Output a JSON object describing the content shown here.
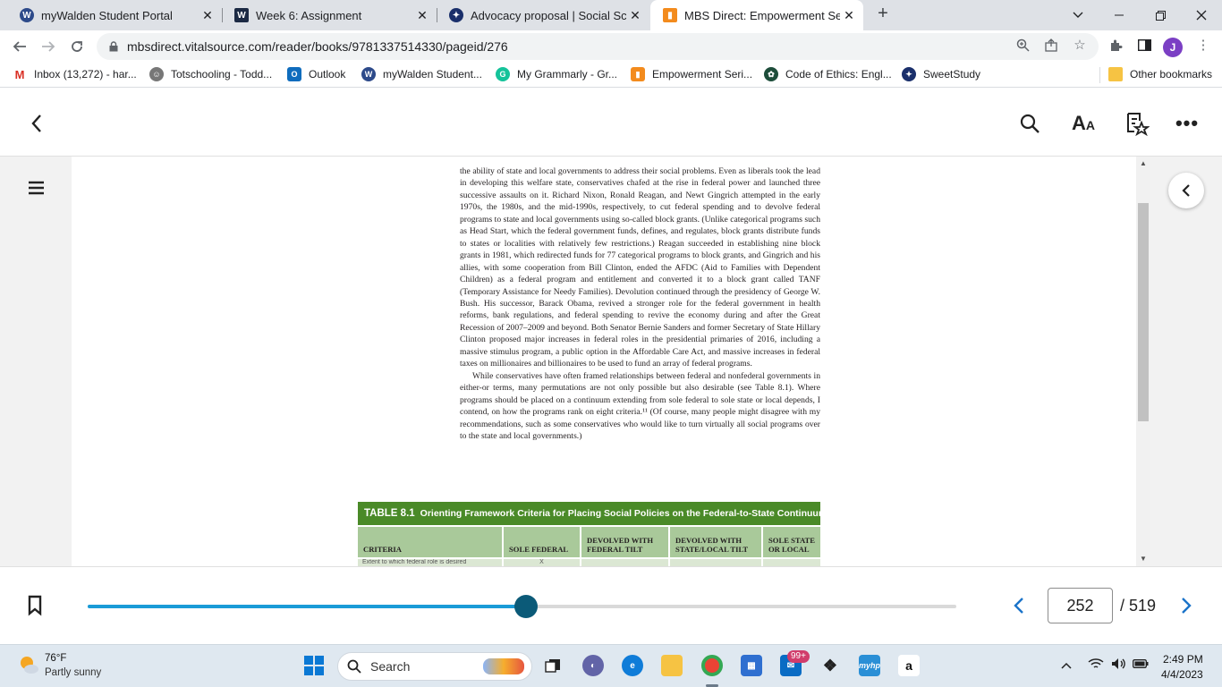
{
  "browser": {
    "tabs": [
      {
        "title": "myWalden Student Portal",
        "icon": "walden-w-icon",
        "color": "#2d4a8a"
      },
      {
        "title": "Week 6: Assignment",
        "icon": "walden-w-square-icon",
        "color": "#1c2a44"
      },
      {
        "title": "Advocacy proposal | Social Scienc",
        "icon": "sweetstudy-icon",
        "color": "#1a2f6b"
      },
      {
        "title": "MBS Direct: Empowerment Series",
        "icon": "mbs-icon",
        "color": "#f38b1d"
      }
    ],
    "url": "mbsdirect.vitalsource.com/reader/books/9781337514330/pageid/276",
    "profile_initial": "J",
    "bookmarks": [
      {
        "label": "Inbox (13,272) - har...",
        "icon": "gmail-icon",
        "color": "#d93025"
      },
      {
        "label": "Totschooling - Todd...",
        "icon": "totschooling-icon",
        "color": "#555555"
      },
      {
        "label": "Outlook",
        "icon": "outlook-icon",
        "color": "#0f6cbd"
      },
      {
        "label": "myWalden Student...",
        "icon": "walden-icon",
        "color": "#2d4a8a"
      },
      {
        "label": "My Grammarly - Gr...",
        "icon": "grammarly-icon",
        "color": "#15c39a"
      },
      {
        "label": "Empowerment Seri...",
        "icon": "mbs-icon",
        "color": "#f38b1d"
      },
      {
        "label": "Code of Ethics: Engl...",
        "icon": "nasw-icon",
        "color": "#1d4d3a"
      },
      {
        "label": "SweetStudy",
        "icon": "sweetstudy-icon",
        "color": "#1a2f6b"
      }
    ],
    "other_bookmarks": "Other bookmarks"
  },
  "reader": {
    "paragraph1": "the ability of state and local governments to address their social problems. Even as liberals took the lead in developing this welfare state, conservatives chafed at the rise in federal power and launched three successive assaults on it. Richard Nixon, Ronald Reagan, and Newt Gingrich attempted in the early 1970s, the 1980s, and the mid-1990s, respectively, to cut federal spending and to devolve federal programs to state and local governments using so-called block grants. (Unlike categorical programs such as Head Start, which the federal government funds, defines, and regulates, block grants distribute funds to states or localities with relatively few restrictions.) Reagan succeeded in establishing nine block grants in 1981, which redirected funds for 77 categorical programs to block grants, and Gingrich and his allies, with some cooperation from Bill Clinton, ended the AFDC (Aid to Families with Dependent Children) as a federal program and entitlement and converted it to a block grant called TANF (Temporary Assistance for Needy Families). Devolution continued through the presidency of George W. Bush. His successor, Barack Obama, revived a stronger role for the federal government in health reforms, bank regulations, and federal spending to revive the economy during and after the Great Recession of 2007–2009 and beyond. Both Senator Bernie Sanders and former Secretary of State Hillary Clinton proposed major increases in federal roles in the presidential primaries of 2016, including a massive stimulus program, a public option in the Affordable Care Act, and massive increases in federal taxes on millionaires and billionaires to be used to fund an array of federal programs.",
    "paragraph2": "While conservatives have often framed relationships between federal and nonfederal governments in either-or terms, many permutations are not only possible but also desirable (see Table 8.1). Where programs should be placed on a continuum extending from sole federal to sole state or local depends, I contend, on how the programs rank on eight criteria.¹¹ (Of course, many people might disagree with my recommendations, such as some conservatives who would like to turn virtually all social programs over to the state and local governments.)",
    "table": {
      "number": "TABLE 8.1",
      "title": "Orienting Framework Criteria for Placing Social Policies on the Federal-to-State Continuum",
      "headers": [
        "CRITERIA",
        "SOLE FEDERAL",
        "DEVOLVED WITH FEDERAL TILT",
        "DEVOLVED WITH STATE/LOCAL TILT",
        "SOLE STATE OR LOCAL"
      ],
      "first_row_partial": [
        "Extent to which federal role is desired",
        "X",
        "",
        "",
        ""
      ]
    },
    "progress_fraction": 0.505,
    "current_page": "252",
    "total_pages": "/ 519"
  },
  "taskbar": {
    "temperature": "76°F",
    "weather": "Partly sunny",
    "search_label": "Search",
    "mail_badge": "99+",
    "time": "2:49 PM",
    "date": "4/4/2023"
  }
}
